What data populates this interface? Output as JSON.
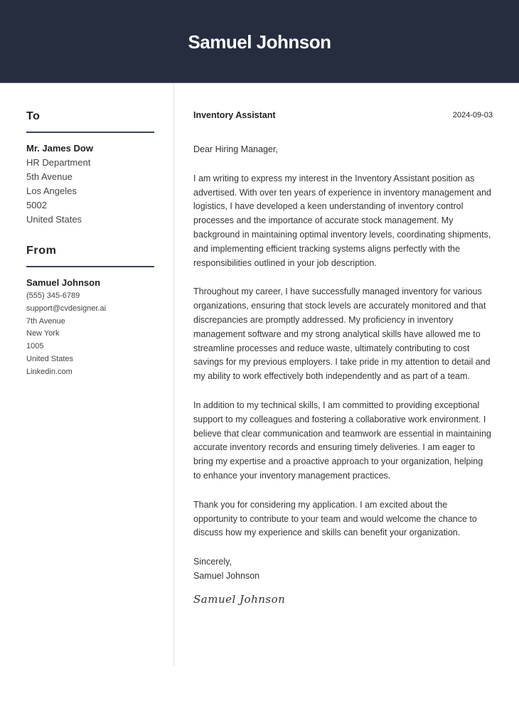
{
  "header": {
    "name": "Samuel Johnson"
  },
  "sidebar": {
    "to": {
      "title": "To",
      "name": "Mr. James Dow",
      "lines": [
        "HR Department",
        "5th Avenue",
        "Los Angeles",
        "5002",
        "United States"
      ]
    },
    "from": {
      "title": "From",
      "name": "Samuel Johnson",
      "lines": [
        "(555) 345-6789",
        "support@cvdesigner.ai",
        "7th Avenue",
        "New York",
        "1005",
        "United States",
        "Linkedin.com"
      ]
    }
  },
  "letter": {
    "job_title": "Inventory Assistant",
    "date": "2024-09-03",
    "greeting": "Dear Hiring Manager,",
    "paragraphs": [
      "I am writing to express my interest in the Inventory Assistant position as advertised. With over ten years of experience in inventory management and logistics, I have developed a keen understanding of inventory control processes and the importance of accurate stock management. My background in maintaining optimal inventory levels, coordinating shipments, and implementing efficient tracking systems aligns perfectly with the responsibilities outlined in your job description.",
      "Throughout my career, I have successfully managed inventory for various organizations, ensuring that stock levels are accurately monitored and that discrepancies are promptly addressed. My proficiency in inventory management software and my strong analytical skills have allowed me to streamline processes and reduce waste, ultimately contributing to cost savings for my previous employers. I take pride in my attention to detail and my ability to work effectively both independently and as part of a team.",
      "In addition to my technical skills, I am committed to providing exceptional support to my colleagues and fostering a collaborative work environment. I believe that clear communication and teamwork are essential in maintaining accurate inventory records and ensuring timely deliveries. I am eager to bring my expertise and a proactive approach to your organization, helping to enhance your inventory management practices.",
      "Thank you for considering my application. I am excited about the opportunity to contribute to your team and would welcome the chance to discuss how my experience and skills can benefit your organization."
    ],
    "closing": "Sincerely,",
    "closing_name": "Samuel Johnson",
    "signature": "Samuel Johnson"
  }
}
